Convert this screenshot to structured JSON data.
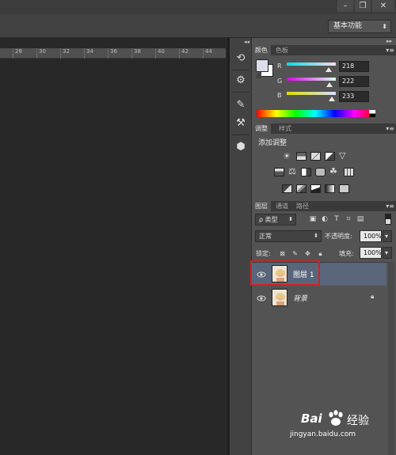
{
  "window": {
    "controls": [
      {
        "label": "–",
        "icon": "minimize-icon"
      },
      {
        "label": "❐",
        "icon": "restore-icon"
      },
      {
        "label": "✕",
        "icon": "close-icon"
      }
    ]
  },
  "options_bar": {
    "workspace": {
      "value": "基本功能",
      "icon": "dropdown-arrow-icon"
    }
  },
  "ruler": {
    "ticks": [
      "28",
      "30",
      "32",
      "34",
      "36",
      "38",
      "40",
      "42",
      "44"
    ]
  },
  "dock": {
    "tools": [
      {
        "icon": "history-icon",
        "glyph": "⟲"
      },
      {
        "icon": "actions-icon",
        "glyph": "⚙"
      },
      {
        "icon": "brush-icon",
        "glyph": "✎"
      },
      {
        "icon": "tool-presets-icon",
        "glyph": "⚒"
      },
      {
        "icon": "3d-cube-icon",
        "glyph": "⬢"
      }
    ]
  },
  "color_panel": {
    "tabs": [
      "颜色",
      "色板"
    ],
    "foreground_color": "#dadee9",
    "channels": [
      {
        "label": "R",
        "value": "218",
        "level": 0.855,
        "gradient": "linear-gradient(to right,#00dee9,#ffdee9)"
      },
      {
        "label": "G",
        "value": "222",
        "level": 0.871,
        "gradient": "linear-gradient(to right,#da00e9,#daffe9)"
      },
      {
        "label": "B",
        "value": "233",
        "level": 0.914,
        "gradient": "linear-gradient(to right,#dade00,#dadeff)"
      }
    ]
  },
  "adjustments_panel": {
    "tabs": [
      "调整",
      "样式"
    ],
    "title": "添加调整",
    "rows": [
      [
        "brightness-contrast-icon",
        "levels-icon",
        "curves-icon",
        "exposure-icon",
        "vibrance-icon"
      ],
      [
        "hue-saturation-icon",
        "color-balance-icon",
        "black-white-icon",
        "photo-filter-icon",
        "channel-mixer-icon",
        "color-lookup-icon"
      ],
      [
        "invert-icon",
        "posterize-icon",
        "threshold-icon",
        "gradient-map-icon",
        "selective-color-icon"
      ]
    ]
  },
  "layers_panel": {
    "tabs": [
      "图层",
      "通道",
      "路径"
    ],
    "filter_kind": "ρ 类型",
    "filter_icons": [
      "pixel-filter-icon",
      "adjustment-filter-icon",
      "type-filter-icon",
      "shape-filter-icon",
      "smart-object-filter-icon"
    ],
    "blend_mode": "正常",
    "opacity_label": "不透明度:",
    "opacity_value": "100%",
    "lock_label": "锁定:",
    "lock_icons": [
      "lock-transparent-icon",
      "lock-image-icon",
      "lock-position-icon",
      "lock-all-icon"
    ],
    "fill_label": "填充:",
    "fill_value": "100%",
    "layers": [
      {
        "name": "图层 1",
        "selected": true,
        "locked": false
      },
      {
        "name": "背景",
        "selected": false,
        "locked": true
      }
    ]
  },
  "watermark": {
    "brand": "Bai",
    "brand2": "经验",
    "url": "jingyan.baidu.com"
  }
}
